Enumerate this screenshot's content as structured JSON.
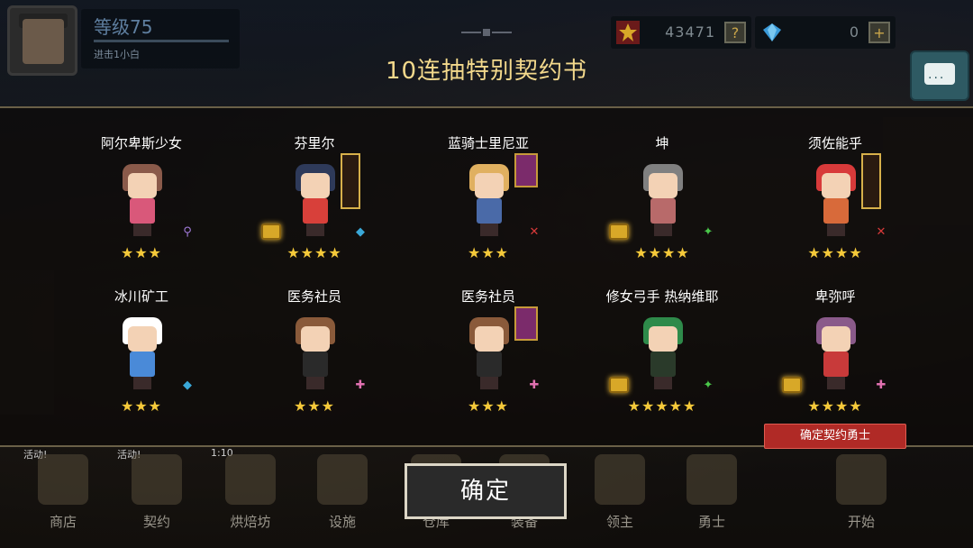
{
  "hud": {
    "level": "等级75",
    "subtitle": "进击1小白",
    "gold": "43471",
    "gold_btn": "?",
    "gems": "0",
    "gems_btn": "+",
    "chat_dots": "..."
  },
  "title": "10连抽特别契约书",
  "heroes": [
    {
      "name": "阿尔卑斯少女",
      "stars": "★★★",
      "cls": "⚲",
      "cls_color": "#a07ad8",
      "hair": "#8a5a4a",
      "body": "#d9587a"
    },
    {
      "name": "芬里尔",
      "stars": "★★★★",
      "cls": "◆",
      "cls_color": "#3aa8d8",
      "hair": "#2e3a5a",
      "body": "#d8403a"
    },
    {
      "name": "蓝骑士里尼亚",
      "stars": "★★★",
      "cls": "✕",
      "cls_color": "#d83a3a",
      "hair": "#e0b060",
      "body": "#4a6aa8"
    },
    {
      "name": "坤",
      "stars": "★★★★",
      "cls": "✦",
      "cls_color": "#4ac84a",
      "hair": "#808080",
      "body": "#b86a6a"
    },
    {
      "name": "须佐能乎",
      "stars": "★★★★",
      "cls": "✕",
      "cls_color": "#d83a3a",
      "hair": "#d83a3a",
      "body": "#d86a3a"
    },
    {
      "name": "冰川矿工",
      "stars": "★★★",
      "cls": "◆",
      "cls_color": "#3aa8d8",
      "hair": "#ffffff",
      "body": "#4a8ad8"
    },
    {
      "name": "医务社员",
      "stars": "★★★",
      "cls": "✚",
      "cls_color": "#e070b0",
      "hair": "#8a5a3a",
      "body": "#2a2a2a"
    },
    {
      "name": "医务社员",
      "stars": "★★★",
      "cls": "✚",
      "cls_color": "#e070b0",
      "hair": "#8a5a3a",
      "body": "#2a2a2a"
    },
    {
      "name": "修女弓手 热纳维耶",
      "stars": "★★★★★",
      "cls": "✦",
      "cls_color": "#4ac84a",
      "hair": "#2e8a4a",
      "body": "#2a3a2a"
    },
    {
      "name": "卑弥呼",
      "stars": "★★★★",
      "cls": "✚",
      "cls_color": "#e070b0",
      "hair": "#8a5a8a",
      "body": "#c83a3a"
    }
  ],
  "confirm_tag": "确定契约勇士",
  "ok_button": "确定",
  "nav": [
    {
      "label": "商店",
      "badge": "活动!"
    },
    {
      "label": "契约",
      "badge": "活动!"
    },
    {
      "label": "烘焙坊",
      "badge": "1:10"
    },
    {
      "label": "设施",
      "badge": ""
    },
    {
      "label": "仓库",
      "badge": ""
    },
    {
      "label": "装备",
      "badge": ""
    },
    {
      "label": "领主",
      "badge": ""
    },
    {
      "label": "勇士",
      "badge": ""
    },
    {
      "label": "",
      "badge": ""
    },
    {
      "label": "开始",
      "badge": ""
    }
  ]
}
